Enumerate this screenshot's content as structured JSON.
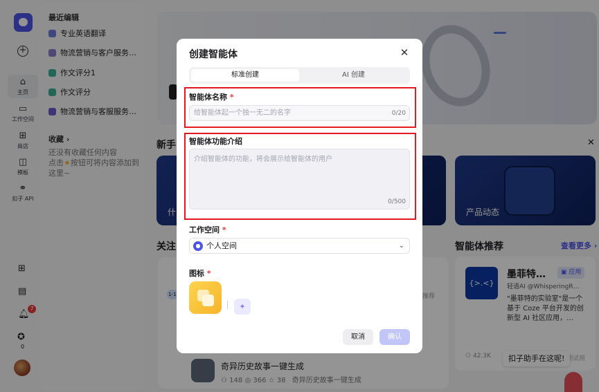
{
  "sidebar": {
    "rail": [
      {
        "label": "主页",
        "icon": "home-icon"
      },
      {
        "label": "工作空间",
        "icon": "workspace-icon"
      },
      {
        "label": "商店",
        "icon": "store-icon"
      },
      {
        "label": "模板",
        "icon": "template-icon"
      },
      {
        "label": "扣子 API",
        "icon": "api-icon"
      }
    ],
    "notification_count": "7",
    "points": "0",
    "recent_title": "最近编辑",
    "recent_items": [
      "专业英语翻译",
      "物流营销与客户服务…",
      "作文评分1",
      "作文评分",
      "物流营销与客服服务…"
    ],
    "favorites_title": "收藏",
    "favorites_empty": "还没有收藏任何内容",
    "favorites_hint": "点击",
    "favorites_hint2": "按钮可将内容添加到这里~"
  },
  "background": {
    "section_new": "新手",
    "section_follow": "关注",
    "card_label": "产品动态",
    "card_label_left": "什",
    "rec_title": "智能体推荐",
    "rec_more": "查看更多",
    "rec_card_title": "墨菲特…",
    "rec_card_badge": "应用",
    "rec_card_author": "轻语AI @WhisperingR…",
    "rec_card_desc": "\"墨菲特的实验室\"是一个基于 Coze 平台开发的创新型 AI 社区应用，…",
    "rec_card_uses": "42.3K",
    "rec_card_tag": "测试用",
    "list_item_title": "奇异历史故事一键生成",
    "list_item_stats": [
      "148",
      "366",
      "38"
    ],
    "list_item_desc": "奇异历史故事一键生成",
    "tag_recommend": "推荐",
    "tooltip": "扣子助手在这呢!"
  },
  "modal": {
    "title": "创建智能体",
    "tabs": [
      "标准创建",
      "AI 创建"
    ],
    "name_label": "智能体名称",
    "name_placeholder": "给智能体起一个独一无二的名字",
    "name_count": "0/20",
    "desc_label": "智能体功能介绍",
    "desc_placeholder": "介绍智能体的功能，将会展示给智能体的用户",
    "desc_count": "0/500",
    "workspace_label": "工作空间",
    "workspace_value": "个人空间",
    "icon_label": "图标",
    "required_mark": "*",
    "cancel": "取消",
    "confirm": "确认"
  },
  "colors": {
    "accent": "#4d53e8",
    "highlight": "#e3171d",
    "danger": "#e8393b"
  }
}
